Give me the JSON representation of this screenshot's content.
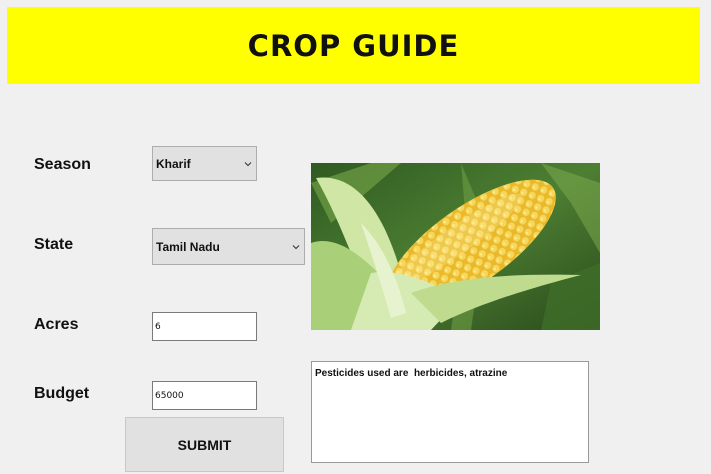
{
  "header": {
    "title": "CROP GUIDE"
  },
  "form": {
    "season_label": "Season",
    "season_value": "Kharif",
    "state_label": "State",
    "state_value": "Tamil Nadu",
    "acres_label": "Acres",
    "acres_value": "6",
    "budget_label": "Budget",
    "budget_value": "65000",
    "submit_label": "SUBMIT"
  },
  "output": {
    "text": "Pesticides used are  herbicides, atrazine"
  },
  "image": {
    "subject": "corn cob"
  },
  "colors": {
    "header_bg": "#ffff00",
    "window_bg": "#f0f0f0"
  }
}
